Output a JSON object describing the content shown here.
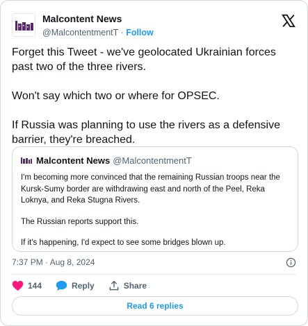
{
  "author": {
    "display_name": "Malcontent News",
    "handle": "@MalcontentmentT",
    "separator": "·",
    "follow_label": "Follow"
  },
  "tweet": {
    "paragraphs": [
      "Forget this Tweet - we've geolocated Ukrainian forces past two of the three rivers.",
      "Won't say which two or where for OPSEC.",
      "If Russia was planning to use the rivers as a defensive barrier, they're breached."
    ]
  },
  "quoted": {
    "display_name": "Malcontent News",
    "handle": "@MalcontentmentT",
    "paragraphs": [
      "I'm becoming more convinced that the remaining Russian troops near the Kursk-Sumy border are withdrawing east and north of the Peel, Reka Loknya, and Reka Stugna Rivers.",
      "The Russian reports support this.",
      "If it's happening, I'd expect to see some bridges blown up."
    ]
  },
  "meta": {
    "timestamp": "7:37 PM · Aug 8, 2024"
  },
  "actions": {
    "like_count": "144",
    "reply_label": "Reply",
    "share_label": "Share"
  },
  "read_replies_label": "Read 6 replies",
  "colors": {
    "accent": "#1d9bf0",
    "like": "#f91880",
    "text": "#0f1419",
    "muted": "#536471",
    "avatar_purple": "#5b2a6e"
  },
  "icons": [
    "x-logo-icon",
    "info-icon",
    "heart-icon",
    "reply-bubble-icon",
    "share-icon"
  ]
}
